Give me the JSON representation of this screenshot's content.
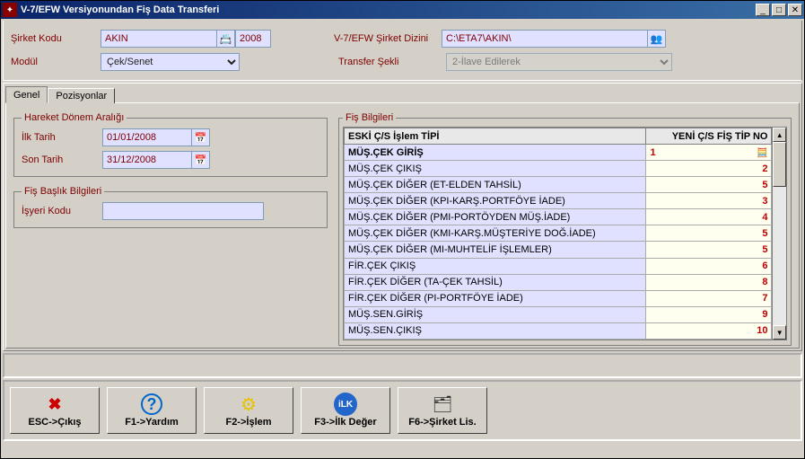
{
  "window": {
    "title": "V-7/EFW Versiyonundan Fiş Data Transferi"
  },
  "form": {
    "sirket_kodu_label": "Şirket Kodu",
    "sirket_kodu_value": "AKIN",
    "sirket_yil_value": "2008",
    "modul_label": "Modül",
    "modul_value": "Çek/Senet",
    "sirket_dizini_label": "V-7/EFW Şirket Dizini",
    "sirket_dizini_value": "C:\\ETA7\\AKIN\\",
    "transfer_sekli_label": "Transfer Şekli",
    "transfer_sekli_value": "2-İlave Edilerek"
  },
  "tabs": {
    "genel": "Genel",
    "pozisyonlar": "Pozisyonlar"
  },
  "hareket_donem": {
    "legend": "Hareket Dönem Aralığı",
    "ilk_tarih_label": "İlk Tarih",
    "ilk_tarih_value": "01/01/2008",
    "son_tarih_label": "Son Tarih",
    "son_tarih_value": "31/12/2008"
  },
  "fis_baslik": {
    "legend": "Fiş Başlık Bilgileri",
    "isyeri_kodu_label": "İşyeri Kodu",
    "isyeri_kodu_value": ""
  },
  "fis_bilgileri": {
    "legend": "Fiş Bilgileri",
    "col1": "ESKİ Ç/S İşlem TİPİ",
    "col2": "YENİ Ç/S FİŞ TİP NO",
    "rows": [
      {
        "name": "MÜŞ.ÇEK GİRİŞ",
        "no": "1",
        "sel": true
      },
      {
        "name": "MÜŞ.ÇEK ÇIKIŞ",
        "no": "2"
      },
      {
        "name": "MÜŞ.ÇEK DİĞER (ET-ELDEN TAHSİL)",
        "no": "5"
      },
      {
        "name": "MÜŞ.ÇEK DİĞER (KPI-KARŞ.PORTFÖYE İADE)",
        "no": "3"
      },
      {
        "name": "MÜŞ.ÇEK DİĞER (PMI-PORTÖYDEN MÜŞ.İADE)",
        "no": "4"
      },
      {
        "name": "MÜŞ.ÇEK DİĞER (KMI-KARŞ.MÜŞTERİYE DOĞ.İADE)",
        "no": "5"
      },
      {
        "name": "MÜŞ.ÇEK DİĞER (MI-MUHTELİF İŞLEMLER)",
        "no": "5"
      },
      {
        "name": "FİR.ÇEK ÇIKIŞ",
        "no": "6"
      },
      {
        "name": "FİR.ÇEK DİĞER (TA-ÇEK TAHSİL)",
        "no": "8"
      },
      {
        "name": "FİR.ÇEK DİĞER (PI-PORTFÖYE İADE)",
        "no": "7"
      },
      {
        "name": "MÜŞ.SEN.GİRİŞ",
        "no": "9"
      },
      {
        "name": "MÜŞ.SEN.ÇIKIŞ",
        "no": "10"
      }
    ]
  },
  "buttons": {
    "esc": "ESC->Çıkış",
    "f1": "F1->Yardım",
    "f2": "F2->İşlem",
    "f3": "F3->İlk Değer",
    "f6": "F6->Şirket Lis.",
    "ilk_icon": "iLK"
  }
}
